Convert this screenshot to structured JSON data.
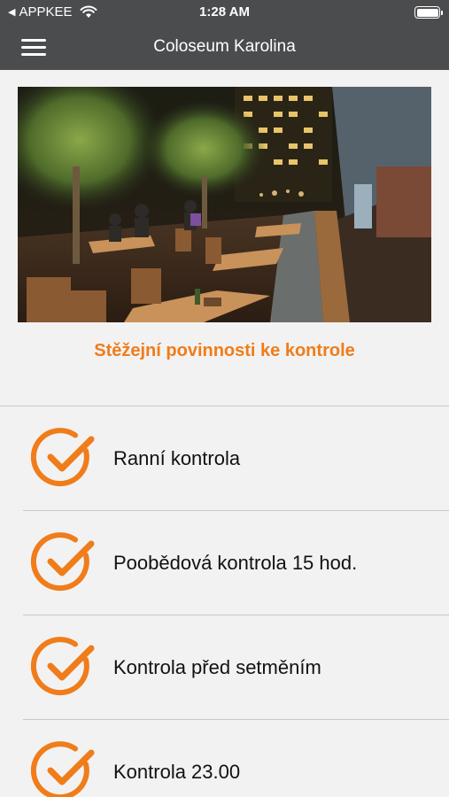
{
  "status_bar": {
    "back_indicator": "◀",
    "carrier": "APPKEE",
    "time": "1:28 AM"
  },
  "nav": {
    "title": "Coloseum Karolina",
    "menu_icon": "hamburger-icon"
  },
  "section_heading": "Stěžejní povinnosti ke kontrole",
  "colors": {
    "accent": "#f07c1a",
    "bar": "#4a4c4d",
    "background": "#f2f2f2"
  },
  "items": [
    {
      "label": "Ranní kontrola",
      "icon": "check-circle-icon"
    },
    {
      "label": "Poobědová kontrola 15 hod.",
      "icon": "check-circle-icon"
    },
    {
      "label": "Kontrola před setměním",
      "icon": "check-circle-icon"
    },
    {
      "label": "Kontrola 23.00",
      "icon": "check-circle-icon"
    }
  ]
}
